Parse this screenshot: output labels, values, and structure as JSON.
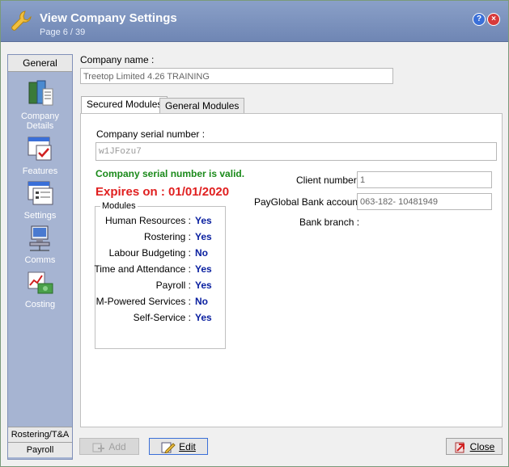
{
  "window": {
    "title": "View Company Settings",
    "page_info": "Page 6 / 39",
    "help_label": "?",
    "close_label": "×"
  },
  "sidebar": {
    "top_tab": "General",
    "items": [
      {
        "label": "Company Details",
        "icon": "company-icon"
      },
      {
        "label": "Features",
        "icon": "features-icon"
      },
      {
        "label": "Settings",
        "icon": "settings-icon"
      },
      {
        "label": "Comms",
        "icon": "comms-icon"
      },
      {
        "label": "Costing",
        "icon": "costing-icon"
      }
    ],
    "bottom_tabs": [
      "Rostering/T&A",
      "Payroll"
    ]
  },
  "company": {
    "name_label": "Company name :",
    "name_value": "Treetop Limited  4.26 TRAINING"
  },
  "tabs": [
    {
      "label": "Secured Modules",
      "active": true
    },
    {
      "label": "General Modules",
      "active": false
    }
  ],
  "secured": {
    "serial_label": "Company serial number :",
    "serial_value": "w1JFozu7",
    "valid_text": "Company serial number is valid.",
    "expires_text": "Expires on : 01/01/2020",
    "client_number_label": "Client number :",
    "client_number_value": "1",
    "bank_account_label": "PayGlobal Bank account :",
    "bank_account_value": "063-182- 10481949",
    "bank_branch_label": "Bank branch :",
    "modules_title": "Modules",
    "modules": [
      {
        "name": "Human Resources :",
        "value": "Yes"
      },
      {
        "name": "Rostering :",
        "value": "Yes"
      },
      {
        "name": "Labour Budgeting :",
        "value": "No"
      },
      {
        "name": "Time and Attendance :",
        "value": "Yes"
      },
      {
        "name": "Payroll :",
        "value": "Yes"
      },
      {
        "name": "M-Powered Services :",
        "value": "No"
      },
      {
        "name": "Self-Service :",
        "value": "Yes"
      }
    ]
  },
  "buttons": {
    "add": "Add",
    "edit": "Edit",
    "close": "Close"
  },
  "colors": {
    "valid": "#1a8a1a",
    "expires": "#e02020",
    "module_value": "#0a20a0",
    "sidebar": "#a6b4d2",
    "titlebar": "#7a90be"
  }
}
